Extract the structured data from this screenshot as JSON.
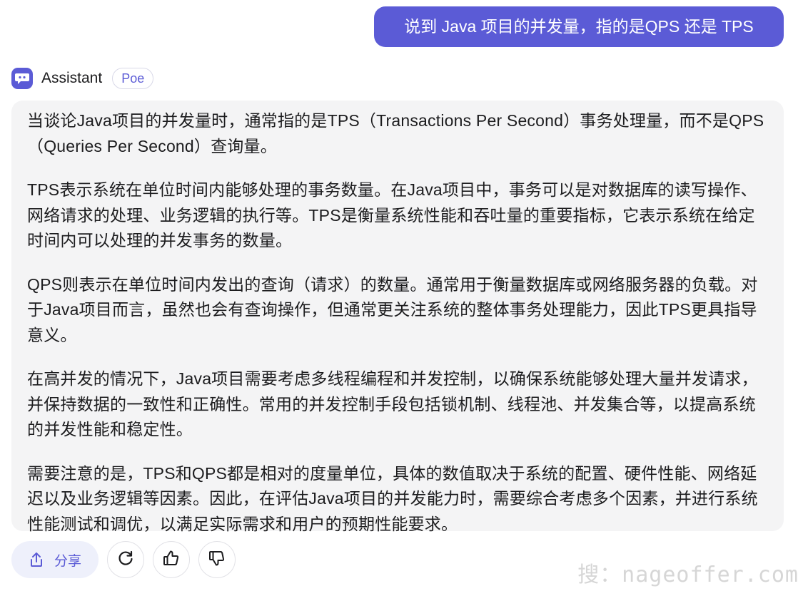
{
  "user_message": "说到 Java 项目的并发量，指的是QPS 还是 TPS",
  "bot": {
    "name": "Assistant",
    "badge": "Poe"
  },
  "answer": {
    "paragraphs": [
      "当谈论Java项目的并发量时，通常指的是TPS（Transactions Per Second）事务处理量，而不是QPS（Queries Per Second）查询量。",
      "TPS表示系统在单位时间内能够处理的事务数量。在Java项目中，事务可以是对数据库的读写操作、网络请求的处理、业务逻辑的执行等。TPS是衡量系统性能和吞吐量的重要指标，它表示系统在给定时间内可以处理的并发事务的数量。",
      "QPS则表示在单位时间内发出的查询（请求）的数量。通常用于衡量数据库或网络服务器的负载。对于Java项目而言，虽然也会有查询操作，但通常更关注系统的整体事务处理能力，因此TPS更具指导意义。",
      "在高并发的情况下，Java项目需要考虑多线程编程和并发控制，以确保系统能够处理大量并发请求，并保持数据的一致性和正确性。常用的并发控制手段包括锁机制、线程池、并发集合等，以提高系统的并发性能和稳定性。",
      "需要注意的是，TPS和QPS都是相对的度量单位，具体的数值取决于系统的配置、硬件性能、网络延迟以及业务逻辑等因素。因此，在评估Java项目的并发能力时，需要综合考虑多个因素，并进行系统性能测试和调优，以满足实际需求和用户的预期性能要求。"
    ]
  },
  "actions": {
    "share_label": "分享",
    "icons": [
      "share-icon",
      "refresh-icon",
      "thumbs-up-icon",
      "thumbs-down-icon"
    ]
  },
  "watermark": "搜：nageoffer.com",
  "colors": {
    "accent": "#5b5bd6",
    "card_bg": "#f4f4f5",
    "share_bg": "#eef0fb"
  }
}
